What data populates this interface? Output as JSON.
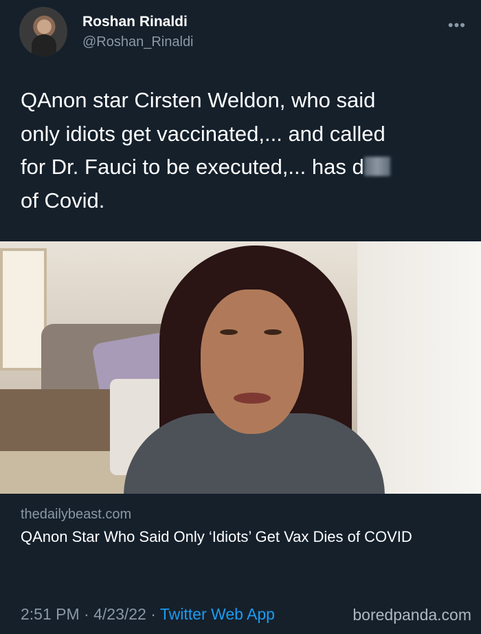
{
  "header": {
    "display_name": "Roshan Rinaldi",
    "handle": "@Roshan_Rinaldi",
    "more_label": "•••"
  },
  "tweet": {
    "text_line1": "QAnon star Cirsten Weldon, who said",
    "text_line2": "only idiots get vaccinated,... and called",
    "text_line3_prefix": "for Dr. Fauci to be executed,... has d",
    "text_line4": "of Covid."
  },
  "card": {
    "domain": "thedailybeast.com",
    "title": "QAnon Star Who Said Only ‘Idiots’ Get Vax Dies of COVID"
  },
  "footer": {
    "time": "2:51 PM",
    "date": "4/23/22",
    "app": "Twitter Web App",
    "separator": "·"
  },
  "watermark": "boredpanda.com",
  "colors": {
    "background": "#15202b",
    "secondary_text": "#8b98a5",
    "link": "#1d9bf0"
  }
}
